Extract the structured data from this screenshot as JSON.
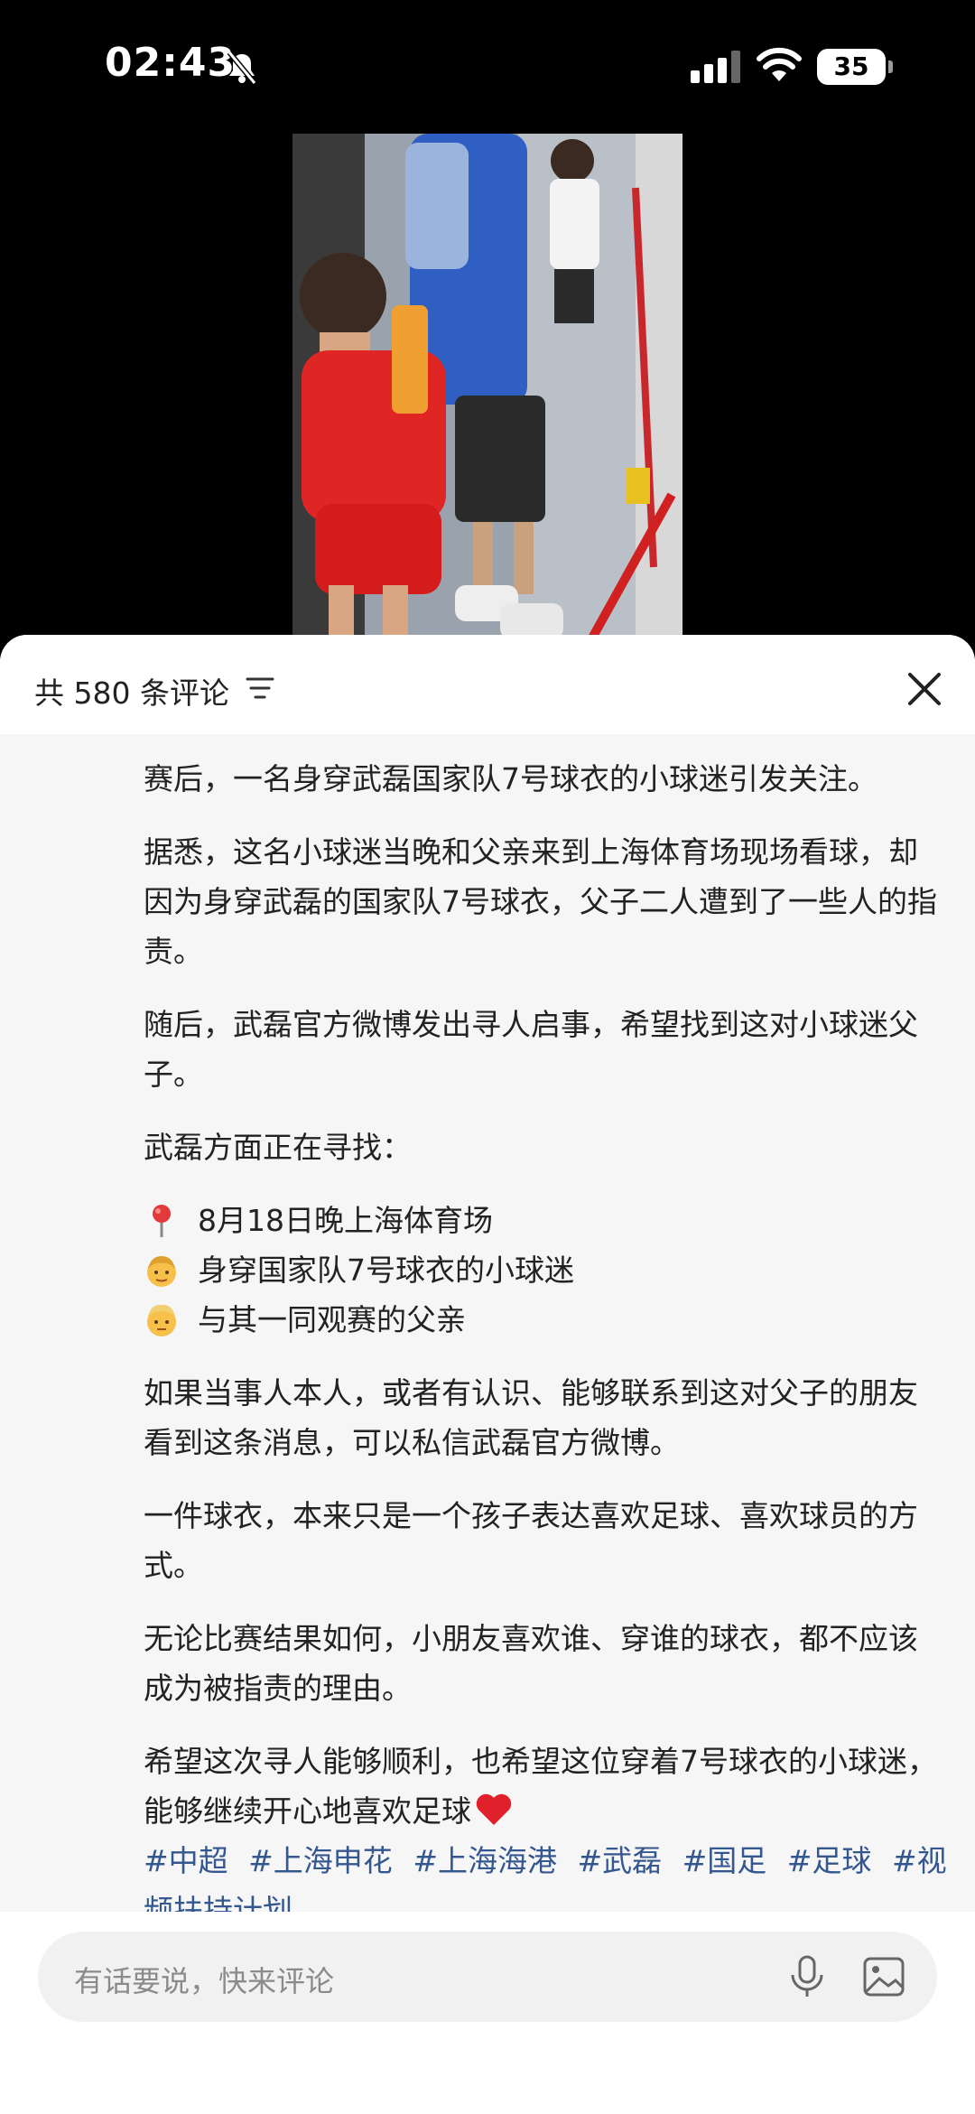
{
  "status_bar": {
    "time": "02:43",
    "battery": "35"
  },
  "comments": {
    "title": "共 580 条评论",
    "paragraphs": [
      "赛后，一名身穿武磊国家队7号球衣的小球迷引发关注。",
      "据悉，这名小球迷当晚和父亲来到上海体育场现场看球，却因为身穿武磊的国家队7号球衣，父子二人遭到了一些人的指责。",
      "随后，武磊官方微博发出寻人启事，希望找到这对小球迷父子。",
      "武磊方面正在寻找："
    ],
    "list": [
      {
        "icon": "pin-icon",
        "text": "8月18日晚上海体育场"
      },
      {
        "icon": "boy-emoji-icon",
        "text": "身穿国家队7号球衣的小球迷"
      },
      {
        "icon": "man-emoji-icon",
        "text": "与其一同观赛的父亲"
      }
    ],
    "paragraphs_after": [
      "如果当事人本人，或者有认识、能够联系到这对父子的朋友看到这条消息，可以私信武磊官方微博。",
      "一件球衣，本来只是一个孩子表达喜欢足球、喜欢球员的方式。",
      "无论比赛结果如何，小朋友喜欢谁、穿谁的球衣，都不应该成为被指责的理由。",
      "希望这次寻人能够顺利，也希望这位穿着7号球衣的小球迷，能够继续开心地喜欢足球"
    ],
    "tags": [
      "#中超",
      "#上海申花",
      "#上海海港",
      "#武磊",
      "#国足",
      "#足球",
      "#视频扶持计划"
    ]
  },
  "input": {
    "placeholder": "有话要说，快来评论"
  },
  "colors": {
    "tag": "#34578f",
    "sheet_bg": "#f6f6f6"
  }
}
